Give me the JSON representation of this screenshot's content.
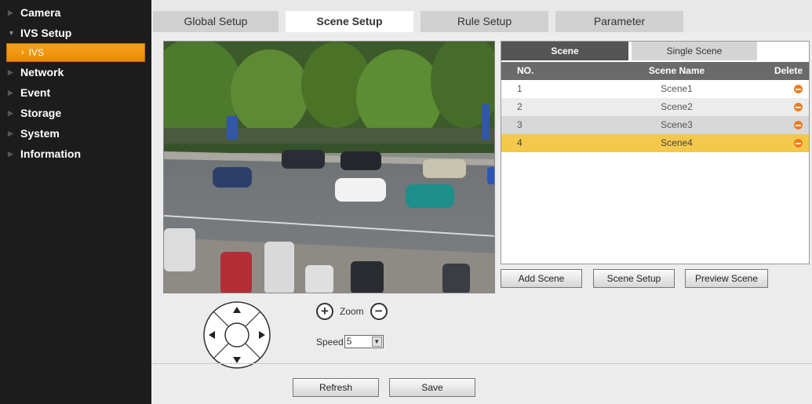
{
  "sidebar": {
    "items": [
      {
        "label": "Camera"
      },
      {
        "label": "IVS Setup"
      },
      {
        "label": "Network"
      },
      {
        "label": "Event"
      },
      {
        "label": "Storage"
      },
      {
        "label": "System"
      },
      {
        "label": "Information"
      }
    ],
    "sub_item": {
      "label": "IVS"
    }
  },
  "tabs": [
    {
      "label": "Global Setup",
      "active": false
    },
    {
      "label": "Scene Setup",
      "active": true
    },
    {
      "label": "Rule Setup",
      "active": false
    },
    {
      "label": "Parameter",
      "active": false
    }
  ],
  "scene_panel": {
    "tabs": [
      {
        "label": "Scene",
        "active": true
      },
      {
        "label": "Single Scene",
        "active": false
      }
    ],
    "headers": {
      "no": "NO.",
      "name": "Scene Name",
      "delete": "Delete"
    },
    "rows": [
      {
        "no": "1",
        "name": "Scene1",
        "selected": false
      },
      {
        "no": "2",
        "name": "Scene2",
        "selected": false
      },
      {
        "no": "3",
        "name": "Scene3",
        "selected": false
      },
      {
        "no": "4",
        "name": "Scene4",
        "selected": true
      }
    ]
  },
  "buttons": {
    "add_scene": "Add Scene",
    "scene_setup": "Scene Setup",
    "preview_scene": "Preview Scene",
    "refresh": "Refresh",
    "save": "Save"
  },
  "ptz": {
    "zoom_label": "Zoom",
    "zoom_in": "+",
    "zoom_out": "−",
    "speed_label": "Speed",
    "speed_value": "5"
  },
  "colors": {
    "sidebar_bg": "#1c1c1c",
    "accent_orange": "#f7a21a",
    "selected_row": "#f4c84a",
    "table_header": "#6a6a6a"
  }
}
